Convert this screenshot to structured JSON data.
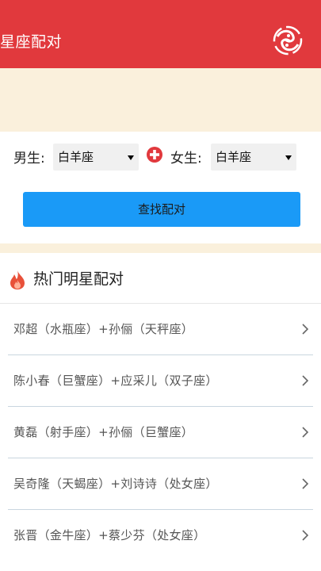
{
  "header": {
    "title": "星座配对",
    "logo_icon": "zodiac-pisces-logo-icon"
  },
  "form": {
    "male_label": "男生:",
    "male_value": "白羊座",
    "female_label": "女生:",
    "female_value": "白羊座",
    "plus_icon": "plus-circle-icon",
    "search_button": "查找配对"
  },
  "hot": {
    "title": "热门明星配对",
    "icon": "fire-icon",
    "items": [
      {
        "label": "邓超（水瓶座）+孙俪（天秤座）"
      },
      {
        "label": "陈小春（巨蟹座）+应采儿（双子座）"
      },
      {
        "label": "黄磊（射手座）+孙俪（巨蟹座）"
      },
      {
        "label": "吴奇隆（天蝎座）+刘诗诗（处女座）"
      },
      {
        "label": "张晋（金牛座）+蔡少芬（处女座）"
      }
    ]
  },
  "colors": {
    "header_bg": "#e1393d",
    "banner_bg": "#faf0dc",
    "button_bg": "#1a9af7"
  }
}
